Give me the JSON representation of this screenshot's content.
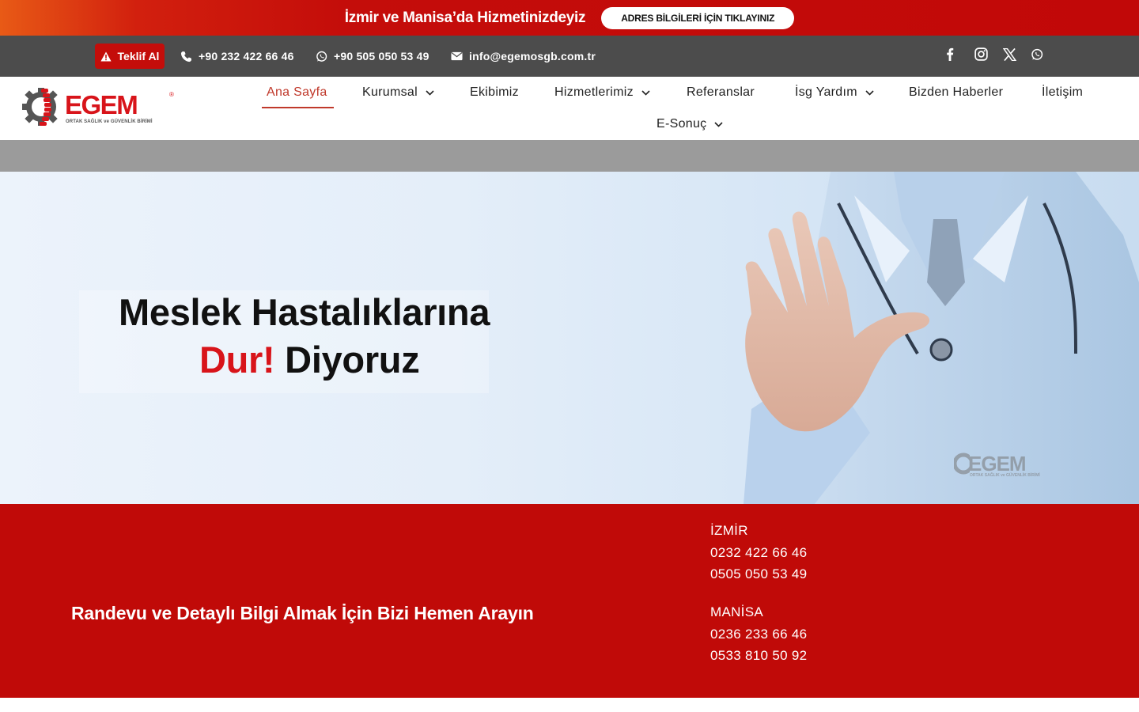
{
  "announcement": {
    "text": "İzmir ve Manisa’da Hizmetinizdeyiz",
    "button_label": "ADRES BİLGİLERİ İÇİN TIKLAYINIZ"
  },
  "contact_bar": {
    "quote_label": "Teklif Al",
    "phone": "+90 232 422 66 46",
    "whatsapp": "+90 505 050 53 49",
    "email": "info@egemosgb.com.tr",
    "social_icons": [
      "facebook-icon",
      "instagram-icon",
      "x-icon",
      "whatsapp-icon"
    ]
  },
  "logo": {
    "word": "EGEM",
    "subtitle": "ORTAK SAĞLIK ve GÜVENLİK BİRİMİ",
    "mark": "®"
  },
  "nav": {
    "items": [
      {
        "label": "Ana Sayfa",
        "active": true,
        "has_dropdown": false
      },
      {
        "label": "Kurumsal",
        "active": false,
        "has_dropdown": true
      },
      {
        "label": "Ekibimiz",
        "active": false,
        "has_dropdown": false
      },
      {
        "label": "Hizmetlerimiz",
        "active": false,
        "has_dropdown": true
      },
      {
        "label": "Referanslar",
        "active": false,
        "has_dropdown": false
      },
      {
        "label": "İsg Yardım",
        "active": false,
        "has_dropdown": true
      },
      {
        "label": "Bizden Haberler",
        "active": false,
        "has_dropdown": false
      },
      {
        "label": "İletişim",
        "active": false,
        "has_dropdown": false
      },
      {
        "label": "E-Sonuç",
        "active": false,
        "has_dropdown": true
      }
    ]
  },
  "hero": {
    "line1": "Meslek Hastalıklarına",
    "line2_highlight": "Dur!",
    "line2_rest": "Diyoruz",
    "watermark_word": "EGEM",
    "watermark_sub": "ORTAK SAĞLIK ve GÜVENLİK BİRİMİ"
  },
  "cta": {
    "title": "Randevu ve Detaylı Bilgi Almak İçin Bizi Hemen Arayın",
    "cities": [
      {
        "name": "İZMİR",
        "phones": [
          "0232 422 66 46",
          "0505 050 53 49"
        ]
      },
      {
        "name": "MANİSA",
        "phones": [
          "0236 233 66 46",
          "0533 810 50 92"
        ]
      }
    ]
  },
  "colors": {
    "brand_red": "#c00a08",
    "active_nav": "#c0392b",
    "contact_bar": "#4c4c4c"
  }
}
